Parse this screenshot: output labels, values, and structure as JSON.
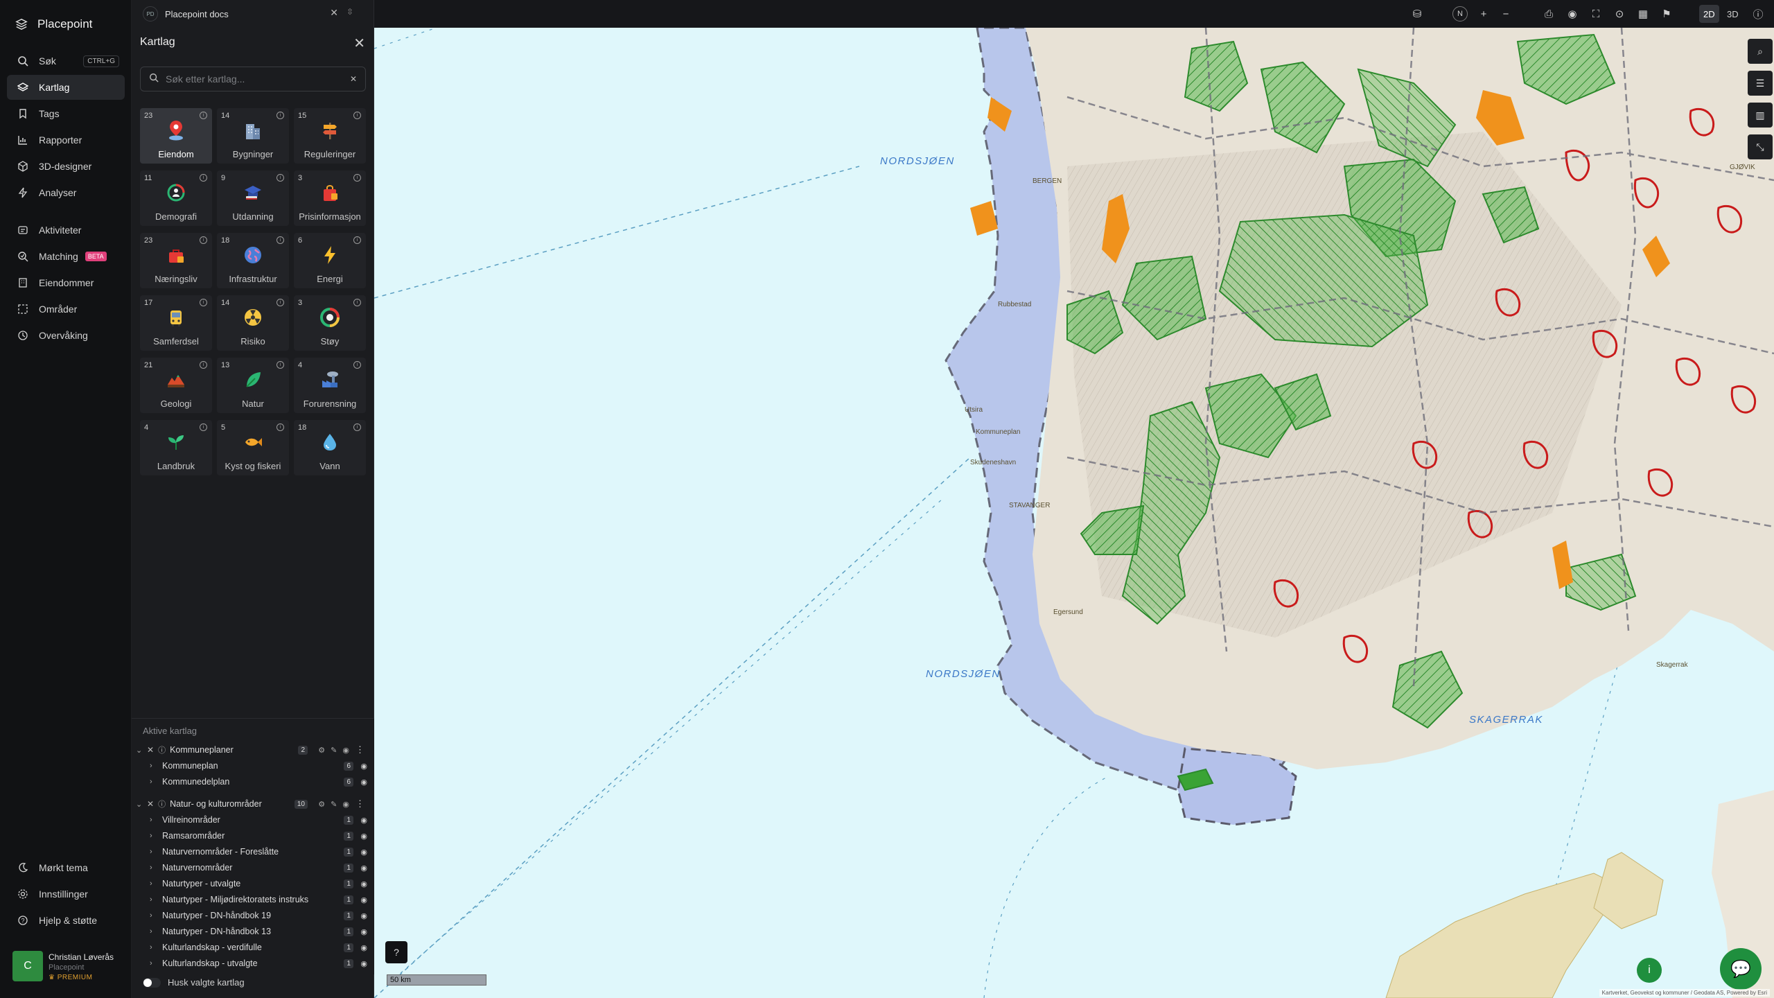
{
  "app": {
    "title": "Placepoint"
  },
  "nav": {
    "items": [
      {
        "label": "Søk",
        "shortcut": "CTRL+G",
        "icon": "search-icon"
      },
      {
        "label": "Kartlag",
        "icon": "layers-icon",
        "active": true
      },
      {
        "label": "Tags",
        "icon": "bookmark-icon"
      },
      {
        "label": "Rapporter",
        "icon": "chart-icon"
      },
      {
        "label": "3D-designer",
        "icon": "cube-icon"
      },
      {
        "label": "Analyser",
        "icon": "bolt-icon"
      },
      {
        "label": "Aktiviteter",
        "icon": "activity-icon"
      },
      {
        "label": "Matching",
        "badge": "BETA",
        "icon": "match-icon"
      },
      {
        "label": "Eiendommer",
        "icon": "building-icon"
      },
      {
        "label": "Områder",
        "icon": "area-icon"
      },
      {
        "label": "Overvåking",
        "icon": "clock-icon"
      }
    ],
    "bottom": [
      {
        "label": "Mørkt tema",
        "icon": "moon-icon"
      },
      {
        "label": "Innstillinger",
        "icon": "gear-icon"
      },
      {
        "label": "Hjelp & støtte",
        "icon": "help-icon"
      }
    ],
    "user": {
      "initial": "C",
      "name": "Christian Løverås",
      "org": "Placepoint",
      "plan": "PREMIUM"
    }
  },
  "doc_tab": {
    "badge": "PD",
    "title": "Placepoint docs"
  },
  "panel": {
    "title": "Kartlag",
    "search_placeholder": "Søk etter kartlag...",
    "categories": [
      {
        "count": "23",
        "label": "Eiendom",
        "icon": "map-pin-icon",
        "active": true
      },
      {
        "count": "14",
        "label": "Bygninger",
        "icon": "buildings-icon"
      },
      {
        "count": "15",
        "label": "Reguleringer",
        "icon": "signpost-icon"
      },
      {
        "count": "11",
        "label": "Demografi",
        "icon": "demography-icon"
      },
      {
        "count": "9",
        "label": "Utdanning",
        "icon": "graduation-icon"
      },
      {
        "count": "3",
        "label": "Prisinformasjon",
        "icon": "shopping-bag-icon"
      },
      {
        "count": "23",
        "label": "Næringsliv",
        "icon": "briefcase-icon"
      },
      {
        "count": "18",
        "label": "Infrastruktur",
        "icon": "globe-icon"
      },
      {
        "count": "6",
        "label": "Energi",
        "icon": "lightning-icon"
      },
      {
        "count": "17",
        "label": "Samferdsel",
        "icon": "bus-icon"
      },
      {
        "count": "14",
        "label": "Risiko",
        "icon": "hazard-icon"
      },
      {
        "count": "3",
        "label": "Støy",
        "icon": "noise-icon"
      },
      {
        "count": "21",
        "label": "Geologi",
        "icon": "terrain-icon"
      },
      {
        "count": "13",
        "label": "Natur",
        "icon": "leaf-icon"
      },
      {
        "count": "4",
        "label": "Forurensning",
        "icon": "factory-icon"
      },
      {
        "count": "4",
        "label": "Landbruk",
        "icon": "sprout-icon"
      },
      {
        "count": "5",
        "label": "Kyst og fiskeri",
        "icon": "fish-icon"
      },
      {
        "count": "18",
        "label": "Vann",
        "icon": "water-drop-icon"
      }
    ],
    "active_title": "Aktive kartlag",
    "groups": [
      {
        "name": "Kommuneplaner",
        "count": "2",
        "layers": [
          {
            "name": "Kommuneplan",
            "count": "6"
          },
          {
            "name": "Kommunedelplan",
            "count": "6"
          }
        ]
      },
      {
        "name": "Natur- og kulturområder",
        "count": "10",
        "layers": [
          {
            "name": "Villreinområder",
            "count": "1"
          },
          {
            "name": "Ramsarområder",
            "count": "1"
          },
          {
            "name": "Naturvernområder - Foreslåtte",
            "count": "1"
          },
          {
            "name": "Naturvernområder",
            "count": "1"
          },
          {
            "name": "Naturtyper - utvalgte",
            "count": "1"
          },
          {
            "name": "Naturtyper - Miljødirektoratets instruks",
            "count": "1"
          },
          {
            "name": "Naturtyper - DN-håndbok 19",
            "count": "1"
          },
          {
            "name": "Naturtyper - DN-håndbok 13",
            "count": "1"
          },
          {
            "name": "Kulturlandskap - verdifulle",
            "count": "1"
          },
          {
            "name": "Kulturlandskap - utvalgte",
            "count": "1"
          }
        ]
      }
    ],
    "remember_label": "Husk valgte kartlag"
  },
  "toolbar": {
    "compass": "N",
    "mode_2d": "2D",
    "mode_3d": "3D",
    "active_mode": "2D"
  },
  "map": {
    "labels": {
      "sea_north": "NORDSJØEN",
      "sea_south": "NORDSJØEN",
      "skagerrak": "SKAGERRAK"
    },
    "places": [
      "BERGEN",
      "Rubbestad",
      "Utsira",
      "Skudeneshavn",
      "STAVANGER",
      "Egersund",
      "Kommuneplan",
      "GJØVIK",
      "Skagerrak"
    ],
    "scale": "50 km",
    "attribution": "Kartverket, Geovekst og kommuner / Geodata AS, Powered by Esri",
    "colors": {
      "sea": "#dff7fb",
      "land": "#e8e2d6",
      "nature": "#3aa335",
      "wetland": "#f0921c",
      "protected": "#c91b1b",
      "plan_area": "#a9b6e6"
    }
  }
}
